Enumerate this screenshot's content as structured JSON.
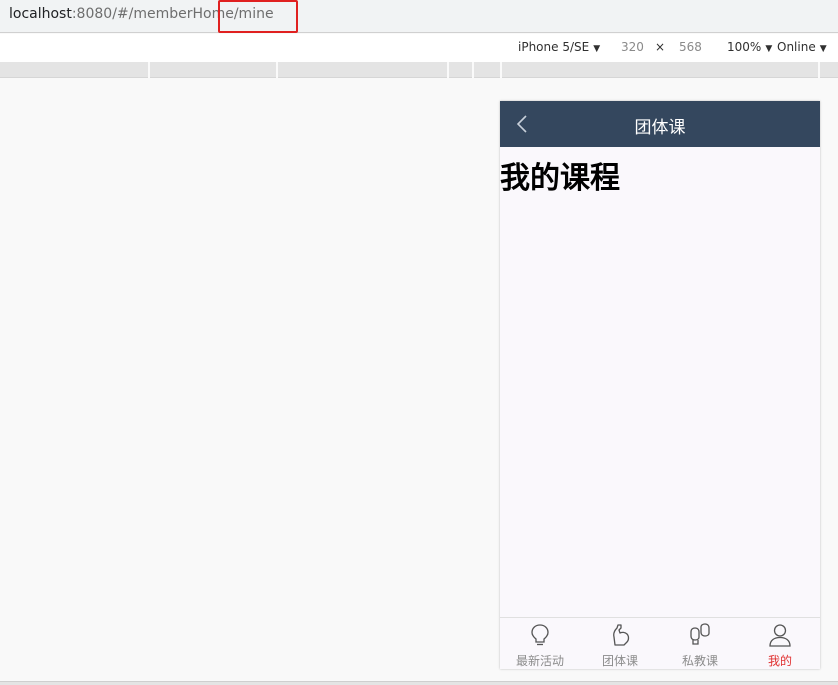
{
  "browser": {
    "url_host": "localhost",
    "url_rest": ":8080/#/memberHome/mine"
  },
  "devtools": {
    "device": "iPhone 5/SE",
    "width": "320",
    "times": "×",
    "height": "568",
    "zoom": "100%",
    "network": "Online"
  },
  "app": {
    "header_title": "团体课",
    "page_title": "我的课程",
    "tabs": [
      {
        "label": "最新活动",
        "icon": "lightbulb-icon",
        "active": false
      },
      {
        "label": "团体课",
        "icon": "flexed-arm-icon",
        "active": false
      },
      {
        "label": "私教课",
        "icon": "boxing-gloves-icon",
        "active": false
      },
      {
        "label": "我的",
        "icon": "user-icon",
        "active": true
      }
    ]
  },
  "colors": {
    "header_bg": "#34475e",
    "active_tab": "#e03030",
    "highlight_box": "#e02020"
  }
}
